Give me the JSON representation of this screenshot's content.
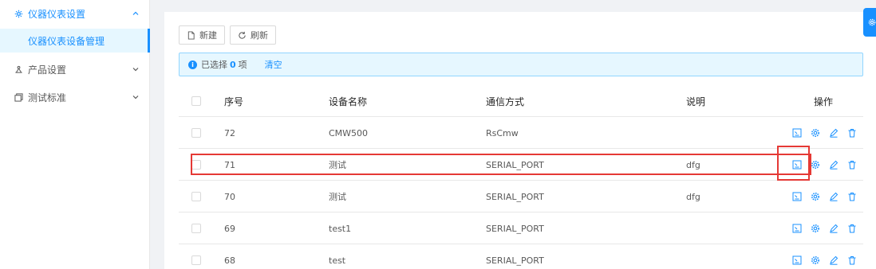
{
  "sidebar": {
    "items": [
      {
        "label": "仪器仪表设置",
        "icon": "settings-icon",
        "expanded": true
      },
      {
        "label": "产品设置",
        "icon": "product-icon",
        "expanded": false
      },
      {
        "label": "测试标准",
        "icon": "standard-icon",
        "expanded": false
      }
    ],
    "submenu": {
      "label": "仪器仪表设备管理"
    }
  },
  "toolbar": {
    "new_label": "新建",
    "refresh_label": "刷新"
  },
  "alert": {
    "prefix": "已选择",
    "count": "0",
    "suffix": "项",
    "clear_label": "清空"
  },
  "table": {
    "headers": {
      "id": "序号",
      "name": "设备名称",
      "comm": "通信方式",
      "desc": "说明",
      "ops": "操作"
    },
    "rows": [
      {
        "id": "72",
        "name": "CMW500",
        "comm": "RsCmw",
        "desc": ""
      },
      {
        "id": "71",
        "name": "测试",
        "comm": "SERIAL_PORT",
        "desc": "dfg"
      },
      {
        "id": "70",
        "name": "测试",
        "comm": "SERIAL_PORT",
        "desc": "dfg"
      },
      {
        "id": "69",
        "name": "test1",
        "comm": "SERIAL_PORT",
        "desc": ""
      },
      {
        "id": "68",
        "name": "test",
        "comm": "SERIAL_PORT",
        "desc": ""
      }
    ]
  },
  "colors": {
    "accent": "#1890ff",
    "highlight": "#e53935"
  }
}
